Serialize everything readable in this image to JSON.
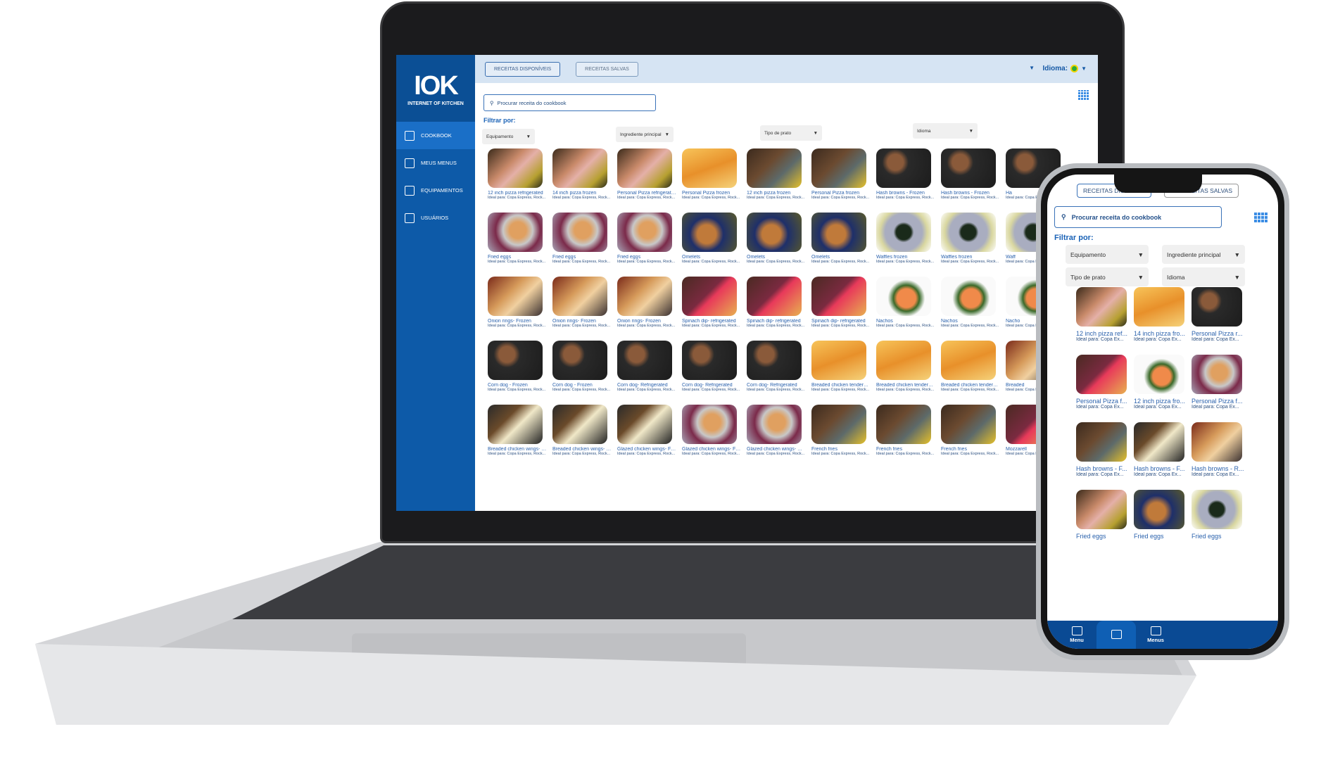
{
  "brand": {
    "logo": "IOK",
    "tagline": "INTERNET OF KITCHEN"
  },
  "sidebar": {
    "items": [
      {
        "label": "COOKBOOK",
        "icon": "cookbook-icon",
        "active": true
      },
      {
        "label": "MEUS MENUS",
        "icon": "menus-icon"
      },
      {
        "label": "EQUIPAMENTOS",
        "icon": "oven-icon"
      },
      {
        "label": "USUÁRIOS",
        "icon": "chef-hat-icon"
      }
    ]
  },
  "header": {
    "tabs": [
      "RECEITAS DISPONÍVEIS",
      "RECEITAS SALVAS"
    ],
    "language_label": "Idioma:",
    "flag": "brazil-flag-icon"
  },
  "search": {
    "placeholder": "Procurar receita do cookbook"
  },
  "filters": {
    "label": "Filtrar por:",
    "options": [
      "Equipamento",
      "Ingrediente principal",
      "Tipo de prato",
      "Idioma"
    ]
  },
  "subtitle": "Ideal para: Copa Express, Rock...",
  "colors": {
    "sidebar": "#0d5aa8",
    "accent": "#1a62b6",
    "header": "#d6e4f3",
    "phone_bar": "#0a4a94"
  },
  "cards": [
    [
      "12 inch pizza refrigerated",
      "roast"
    ],
    [
      "14 inch pizza frozen",
      "roast"
    ],
    [
      "Personal Pizza refrigerated",
      "roast"
    ],
    [
      "Personal Pizza frozen",
      "fries"
    ],
    [
      "12 inch pizza frozen",
      "steak"
    ],
    [
      "Personal Pizza frozen",
      "steak"
    ],
    [
      "Hash browns - Frozen",
      "chop"
    ],
    [
      "Hash browns - Frozen",
      "chop"
    ],
    [
      "Ha",
      "chop"
    ],
    [
      "Fried eggs",
      "croissant"
    ],
    [
      "Fried eggs",
      "croissant"
    ],
    [
      "Fried eggs",
      "croissant"
    ],
    [
      "Omelets",
      "chicken"
    ],
    [
      "Omelets",
      "chicken"
    ],
    [
      "Omelets",
      "chicken"
    ],
    [
      "Waffles frozen",
      "macaron"
    ],
    [
      "Waffles frozen",
      "macaron"
    ],
    [
      "Waff",
      "macaron"
    ],
    [
      "Onion rings- Frozen",
      "cordon"
    ],
    [
      "Onion rings- Frozen",
      "cordon"
    ],
    [
      "Onion rings- Frozen",
      "cordon"
    ],
    [
      "Spinach dip- refrigerated",
      "muffin"
    ],
    [
      "Spinach dip- refrigerated",
      "muffin"
    ],
    [
      "Spinach dip- refrigerated",
      "muffin"
    ],
    [
      "Nachos",
      "salmon"
    ],
    [
      "Nachos",
      "salmon"
    ],
    [
      "Nacho",
      "salmon"
    ],
    [
      "Corn dog - Frozen",
      "chop"
    ],
    [
      "Corn dog - Frozen",
      "chop"
    ],
    [
      "Corn dog- Refrigerated",
      "chop"
    ],
    [
      "Corn dog- Refrigerated",
      "chop"
    ],
    [
      "Corn dog- Refrigerated",
      "chop"
    ],
    [
      "Breaded chicken tenders -...",
      "fries"
    ],
    [
      "Breaded chicken tenders -...",
      "fries"
    ],
    [
      "Breaded chicken tenders -...",
      "fries"
    ],
    [
      "Breaded",
      "cordon"
    ],
    [
      "Breaded chicken wings- Fr...",
      "fish"
    ],
    [
      "Breaded chicken wings- R...",
      "fish"
    ],
    [
      "Glazed chicken wings- Fro...",
      "fish"
    ],
    [
      "Glazed chicken wings- Fro...",
      "croissant"
    ],
    [
      "Glazed chicken wings- Ref...",
      "croissant"
    ],
    [
      "French fries",
      "steak"
    ],
    [
      "French fries",
      "steak"
    ],
    [
      "French fries",
      "steak"
    ],
    [
      "Mozzarell",
      "muffin"
    ]
  ],
  "phone": {
    "tabs": [
      "RECEITAS DISPONÍVEIS",
      "RECEITAS SALVAS"
    ],
    "subtitle": "Ideal para: Copa Ex...",
    "cards": [
      [
        "12 inch pizza ref...",
        "roast",
        true
      ],
      [
        "14 inch pizza fro...",
        "fries",
        true
      ],
      [
        "Personal Pizza r...",
        "chop",
        true
      ],
      [
        "Personal Pizza f...",
        "muffin",
        true
      ],
      [
        "12 inch pizza fro...",
        "salmon",
        true
      ],
      [
        "Personal Pizza f...",
        "croissant",
        true
      ],
      [
        "Hash browns - F...",
        "steak",
        true
      ],
      [
        "Hash browns - F...",
        "fish",
        true
      ],
      [
        "Hash browns - R...",
        "cordon",
        true
      ],
      [
        "Fried eggs",
        "roast",
        false
      ],
      [
        "Fried eggs",
        "chicken",
        false
      ],
      [
        "Fried eggs",
        "macaron",
        false
      ]
    ],
    "nav": [
      {
        "label": "Menu",
        "icon": "hamburger-menu-icon"
      },
      {
        "label": "",
        "icon": "cookbook-icon",
        "active": true
      },
      {
        "label": "Menus",
        "icon": "menus-icon"
      }
    ]
  }
}
